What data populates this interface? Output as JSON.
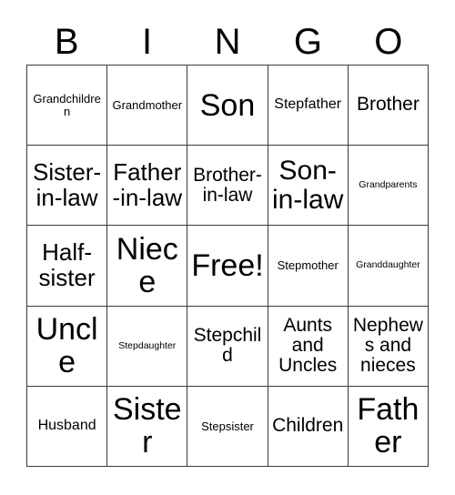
{
  "card": {
    "title": "Bingo Card",
    "header_letters": [
      "B",
      "I",
      "N",
      "G",
      "O"
    ],
    "grid_line_color": "#3a3a3a",
    "background_color": "#ffffff",
    "text_color": "#000000",
    "rows": 5,
    "columns": 5,
    "free_space": "Free!",
    "cells": [
      [
        {
          "label": "Grandchildren",
          "size": "xs"
        },
        {
          "label": "Grandmother",
          "size": "xs"
        },
        {
          "label": "Son",
          "size": "xxl"
        },
        {
          "label": "Stepfather",
          "size": "sm"
        },
        {
          "label": "Brother",
          "size": "md"
        }
      ],
      [
        {
          "label": "Sister-in-law",
          "size": "lg"
        },
        {
          "label": "Father-in-law",
          "size": "lg"
        },
        {
          "label": "Brother-in-law",
          "size": "md"
        },
        {
          "label": "Son-in-law",
          "size": "xl"
        },
        {
          "label": "Grandparents",
          "size": "xxs"
        }
      ],
      [
        {
          "label": "Half-sister",
          "size": "lg"
        },
        {
          "label": "Niece",
          "size": "xxl"
        },
        {
          "label": "Free!",
          "size": "xxl"
        },
        {
          "label": "Stepmother",
          "size": "xs"
        },
        {
          "label": "Granddaughter",
          "size": "xxs"
        }
      ],
      [
        {
          "label": "Uncle",
          "size": "xxl"
        },
        {
          "label": "Stepdaughter",
          "size": "xxs"
        },
        {
          "label": "Stepchild",
          "size": "md"
        },
        {
          "label": "Aunts and Uncles",
          "size": "md"
        },
        {
          "label": "Nephews and nieces",
          "size": "md"
        }
      ],
      [
        {
          "label": "Husband",
          "size": "sm"
        },
        {
          "label": "Sister",
          "size": "xxl"
        },
        {
          "label": "Stepsister",
          "size": "xs"
        },
        {
          "label": "Children",
          "size": "md"
        },
        {
          "label": "Father",
          "size": "xxl"
        }
      ]
    ]
  }
}
